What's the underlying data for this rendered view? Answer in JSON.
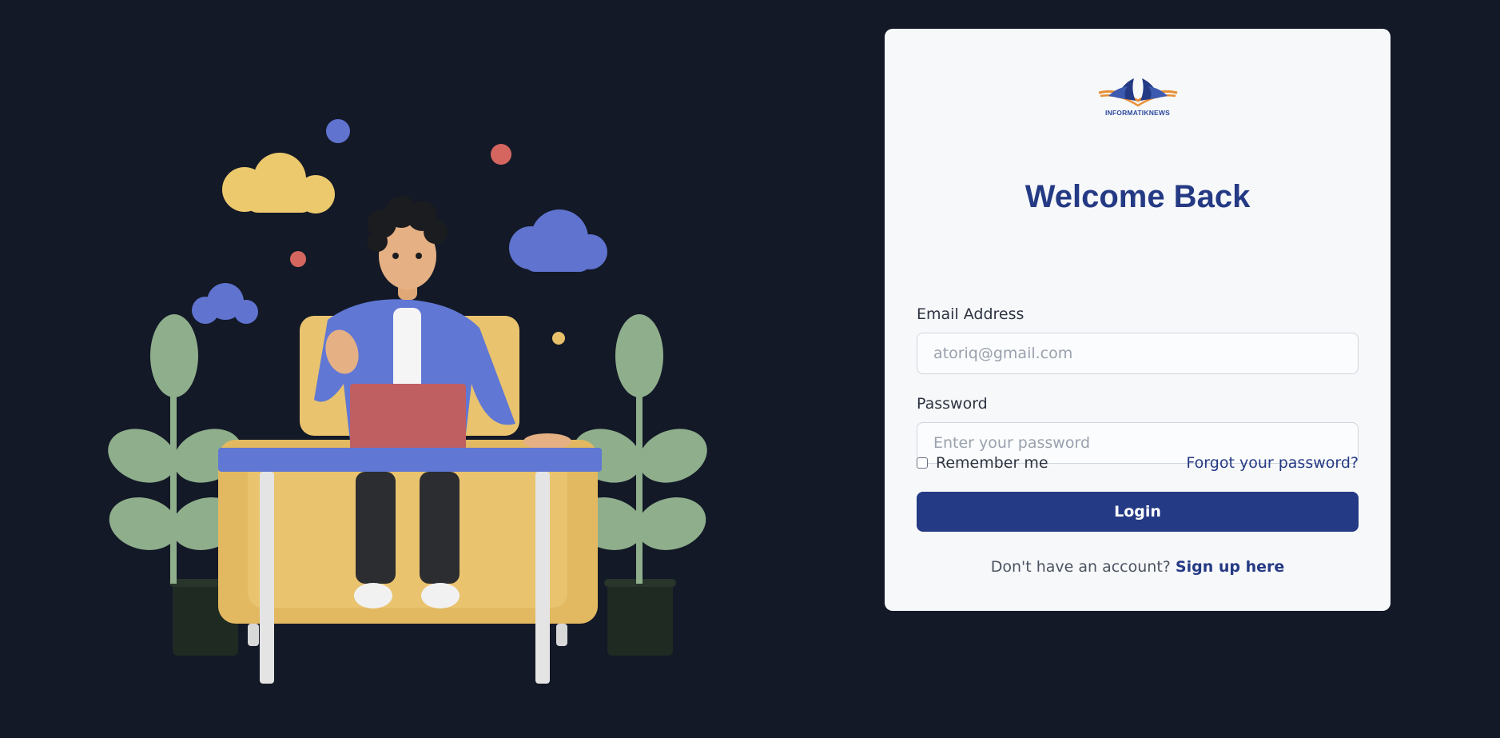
{
  "logo": {
    "text": "INFORMATIKNEWS",
    "colors": {
      "orange": "#e78f34",
      "blue": "#253a84"
    }
  },
  "form": {
    "title": "Welcome Back",
    "email": {
      "label": "Email Address",
      "placeholder": "atoriq@gmail.com"
    },
    "password": {
      "label": "Password",
      "placeholder": "Enter your password"
    },
    "remember_label": "Remember me",
    "forgot_label": "Forgot your password?",
    "login_label": "Login",
    "signup_prompt": "Don't have an account?",
    "signup_link": "Sign up here"
  },
  "colors": {
    "background": "#131927",
    "card": "#f7f8fa",
    "accent": "#253a84"
  },
  "icons": {
    "illustration": "person-at-desk-illustration",
    "checkbox": "checkbox-unchecked"
  }
}
